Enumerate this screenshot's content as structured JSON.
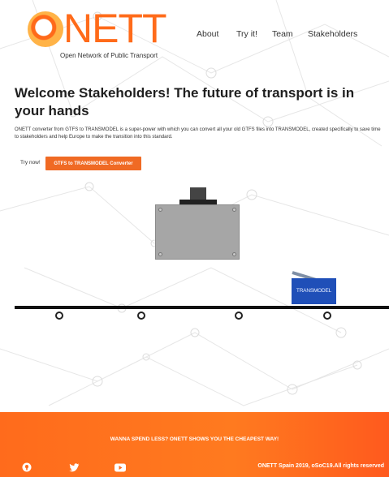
{
  "brand": {
    "logo_word": "NETT",
    "tagline": "Open Network of Public Transport",
    "accent_color": "#ff6b1a"
  },
  "nav": {
    "items": [
      {
        "label": "About"
      },
      {
        "label": "Try it!"
      },
      {
        "label": "Team"
      },
      {
        "label": "Stakeholders"
      }
    ]
  },
  "hero": {
    "headline": "Welcome Stakeholders! The future of transport is in your hands",
    "intro": "ONETT converter from GTFS to TRANSMODEL is a super-power with which you can convert all your old GTFS files into TRANSMODEL, created specifically to save time to stakeholders and help Europe to make the transition into this standard.",
    "try_label": "Try now!",
    "cta_label": "GTFS to TRANSMODEL Converter",
    "cta_color": "#f06a24"
  },
  "illustration": {
    "output_box_label": "TRANSMODEL",
    "output_box_color": "#1f4fb8"
  },
  "footer": {
    "message": "WANNA SPEND LESS? ONETT SHOWS YOU THE CHEAPEST WAY!",
    "copyright": "ONETT Spain 2019, oSoC19.All rights reserved",
    "social": [
      {
        "icon": "github-icon"
      },
      {
        "icon": "twitter-icon"
      },
      {
        "icon": "youtube-icon"
      }
    ],
    "background_color": "#ff6b1c"
  }
}
